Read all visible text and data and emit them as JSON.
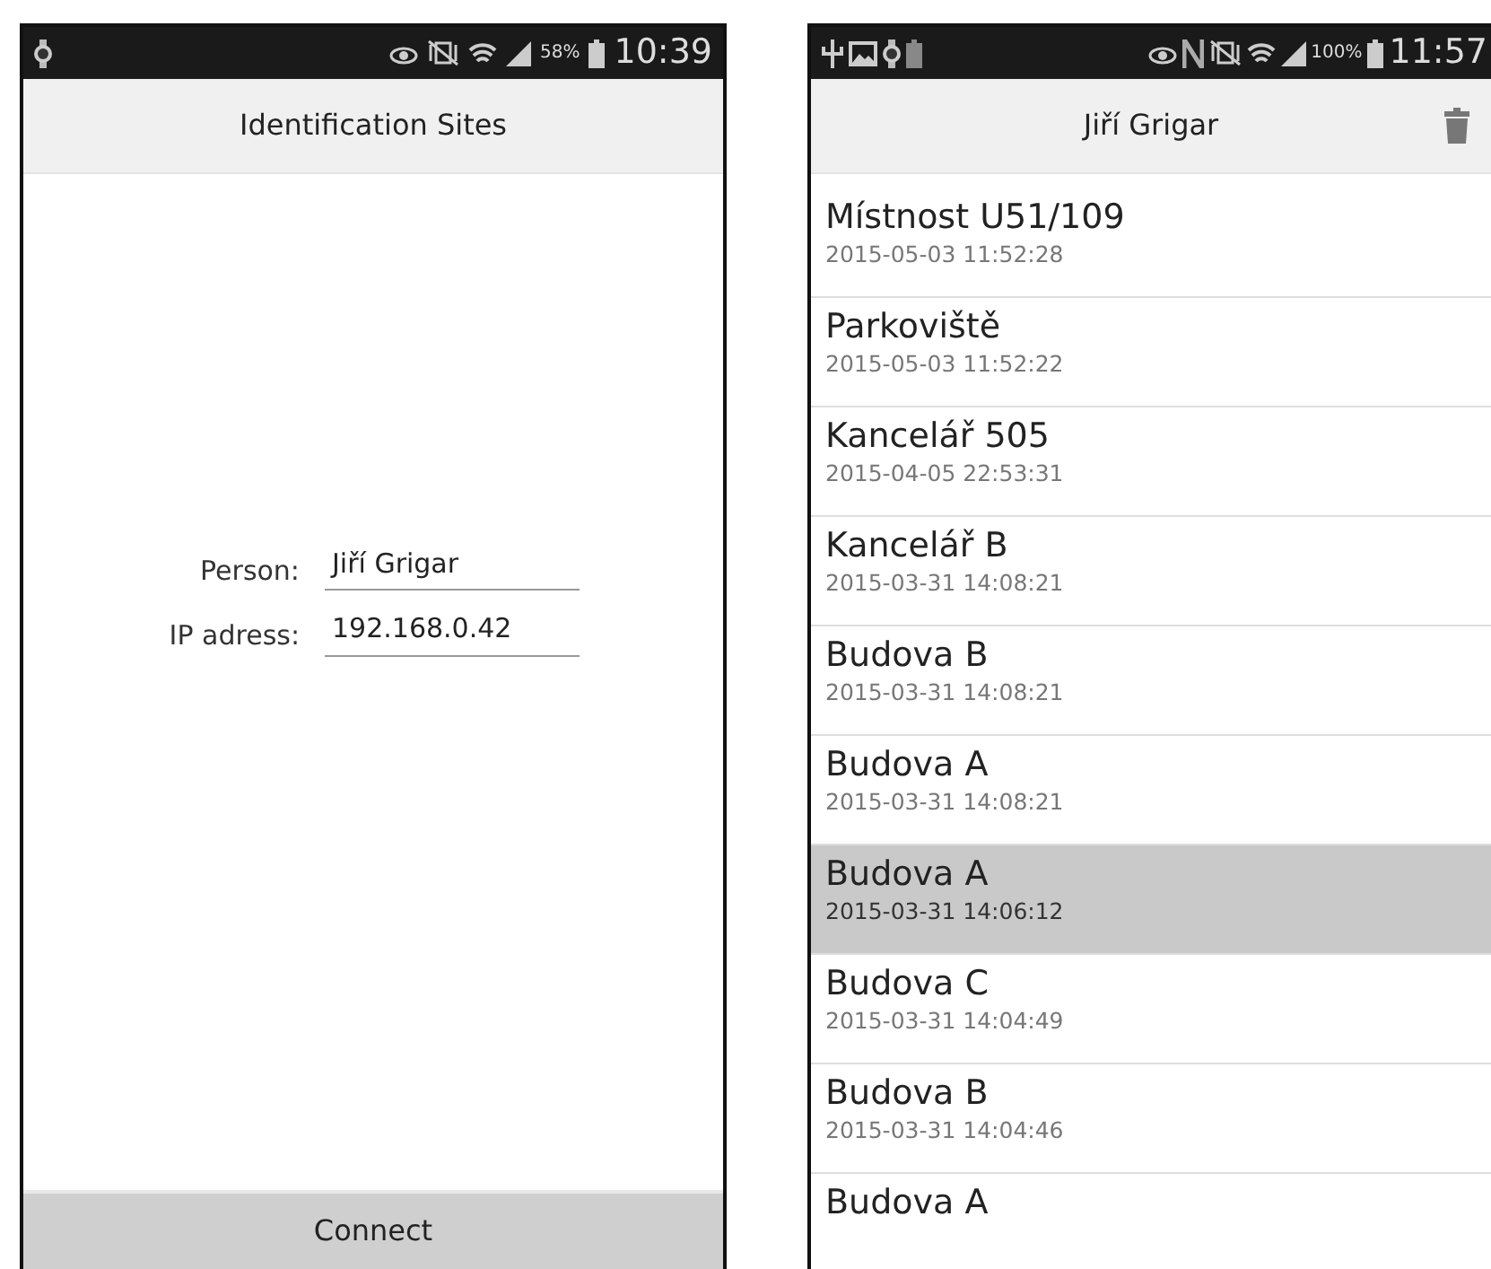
{
  "connect_screen": {
    "status_bar": {
      "battery": "58%",
      "time": "10:39"
    },
    "title": "Identification Sites",
    "fields": [
      {
        "label": "Person:",
        "value": "Jiří Grigar"
      },
      {
        "label": "IP adress:",
        "value": "192.168.0.42"
      }
    ],
    "button": "Connect"
  },
  "history_screen": {
    "status_bar": {
      "battery": "100%",
      "time": "11:57"
    },
    "title": "Jiří Grigar",
    "items": [
      {
        "name": "Místnost U51/109",
        "time": "2015-05-03 11:52:28",
        "selected": false
      },
      {
        "name": "Parkoviště",
        "time": "2015-05-03 11:52:22",
        "selected": false
      },
      {
        "name": "Kancelář 505",
        "time": "2015-04-05 22:53:31",
        "selected": false
      },
      {
        "name": "Kancelář B",
        "time": "2015-03-31 14:08:21",
        "selected": false
      },
      {
        "name": "Budova B",
        "time": "2015-03-31 14:08:21",
        "selected": false
      },
      {
        "name": "Budova A",
        "time": "2015-03-31 14:08:21",
        "selected": false
      },
      {
        "name": "Budova A",
        "time": "2015-03-31 14:06:12",
        "selected": true
      },
      {
        "name": "Budova C",
        "time": "2015-03-31 14:04:49",
        "selected": false
      },
      {
        "name": "Budova B",
        "time": "2015-03-31 14:04:46",
        "selected": false
      },
      {
        "name": "Budova A",
        "selected": false
      }
    ]
  }
}
